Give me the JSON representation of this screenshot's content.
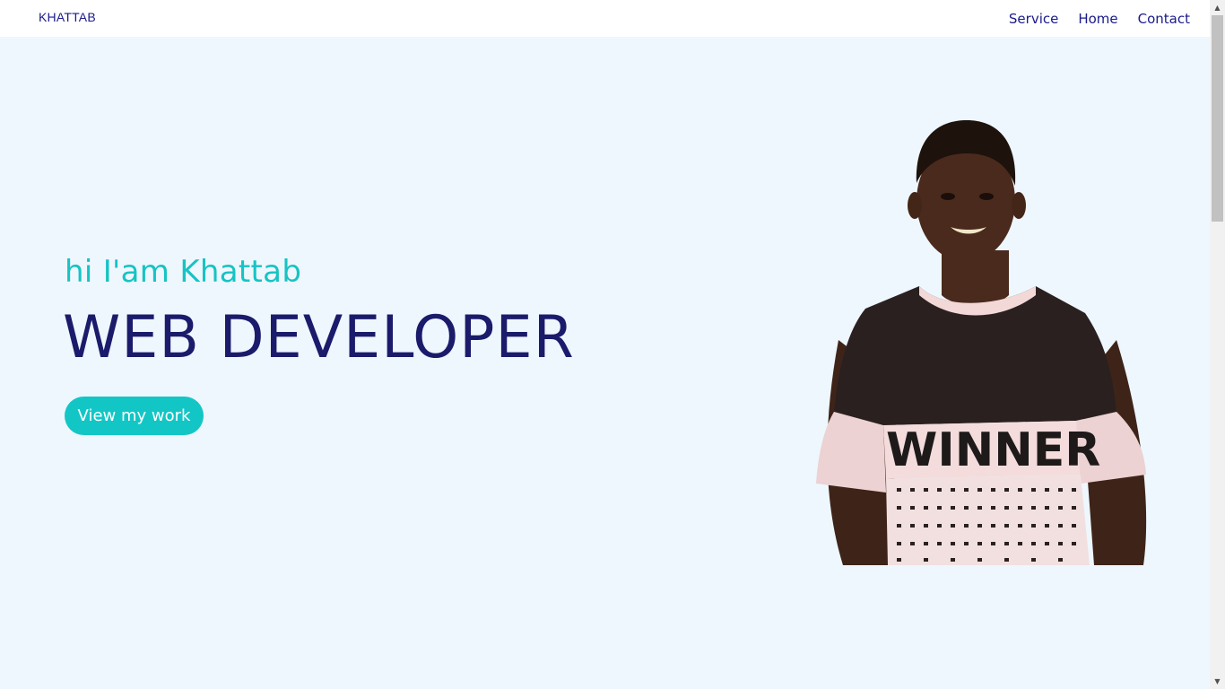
{
  "nav": {
    "logo": "KHATTAB",
    "links": [
      "Service",
      "Home",
      "Contact"
    ]
  },
  "hero": {
    "greeting": "hi I'am Khattab",
    "role": "WEB DEVELOPER",
    "cta_label": "View my work",
    "portrait_shirt_text": "WINNER"
  },
  "colors": {
    "background": "#eef7fe",
    "nav_text": "#1a1a8c",
    "greeting": "#17c3c3",
    "role": "#1b1b6b",
    "cta_bg": "#13c6c6"
  },
  "icons": {
    "scroll_up": "triangle-up",
    "scroll_down": "triangle-down"
  }
}
